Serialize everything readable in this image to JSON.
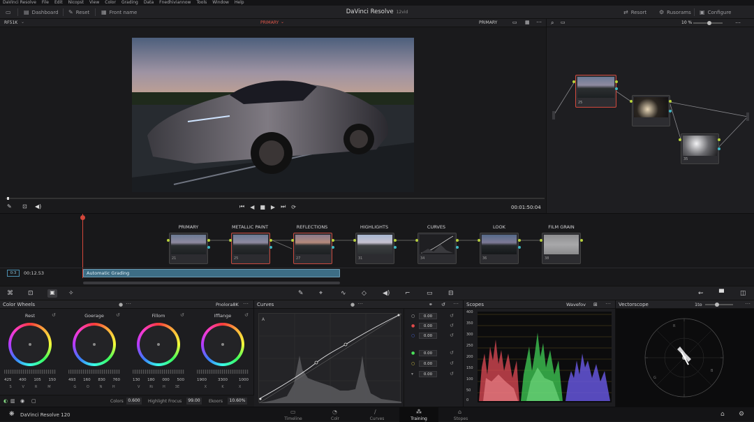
{
  "menu": [
    "DaVinci Resolve",
    "File",
    "Edit",
    "Nicopst",
    "View",
    "Color",
    "Grading",
    "Data",
    "Fnedhiviannow",
    "Tools",
    "Window",
    "Help"
  ],
  "topbar": {
    "dashboard": "Dashboard",
    "reset": "Reset",
    "frontname": "Front name",
    "title": "DaVinci Resolve",
    "title_sub": "12vid",
    "resort": "Resort",
    "rusorams": "Rusorams",
    "configure": "Configure"
  },
  "viewerbar": {
    "left": "RF51K",
    "center": "PRIMARY",
    "right": "PRIMARY"
  },
  "nodebar": {
    "zoom": "10 %"
  },
  "viewer": {
    "timecode": "00:01:50:04"
  },
  "nodes": [
    {
      "id": "25"
    },
    {
      "id": ""
    },
    {
      "id": "35"
    }
  ],
  "timeline": {
    "track": "0:3",
    "timecode": "00:12.53",
    "clip_name": "Automatic Grading",
    "clips": [
      {
        "label": "PRIMARY",
        "id": "21"
      },
      {
        "label": "METALLIC PAINT",
        "id": "25"
      },
      {
        "label": "REFLECTIONS",
        "id": "27"
      },
      {
        "label": "HIGHLIGHTS",
        "id": "31"
      },
      {
        "label": "CURVES",
        "id": "34"
      },
      {
        "label": "LOOK",
        "id": "36"
      },
      {
        "label": "FILM GRAIN",
        "id": "38"
      }
    ]
  },
  "wheels": {
    "title": "Color Wheels",
    "mode": "Pnolora8K",
    "items": [
      {
        "label": "Rest",
        "vals": [
          "425",
          "400",
          "105",
          "150"
        ],
        "letters": [
          "S",
          "V",
          "R",
          "M"
        ]
      },
      {
        "label": "Goerage",
        "vals": [
          "493",
          "160",
          "830",
          "760"
        ],
        "letters": [
          "G",
          "O",
          "N",
          "H"
        ]
      },
      {
        "label": "Fillom",
        "vals": [
          "130",
          "180",
          "000",
          "500"
        ],
        "letters": [
          "V",
          "Ri",
          "H",
          "3E"
        ]
      },
      {
        "label": "Ifflange",
        "vals": [
          "1900",
          "3300",
          "1000"
        ],
        "letters": [
          "X",
          "K",
          "X"
        ]
      }
    ],
    "colors_label": "Colors",
    "colors_val": "0.600",
    "hl_label": "Highlight Frocus",
    "hl_val": "99.00",
    "ekoors_label": "Ekoors",
    "ekoors_val": "10.60%"
  },
  "curves": {
    "title": "Curves",
    "values": [
      "0.00",
      "0.00",
      "0.00",
      "0.00",
      "0.00",
      "0.00"
    ]
  },
  "scopes": {
    "title": "Scopes",
    "mode": "Wavefov",
    "ticks": [
      "400",
      "350",
      "300",
      "250",
      "200",
      "150",
      "100",
      "50",
      "0"
    ]
  },
  "vectorscope": {
    "title": "Vectorscope",
    "zoom": "1to"
  },
  "bottom": {
    "app": "DaVinci Resolve 120",
    "tabs": [
      "Timeline",
      "Colr",
      "Curves",
      "Training",
      "Stopes"
    ]
  }
}
